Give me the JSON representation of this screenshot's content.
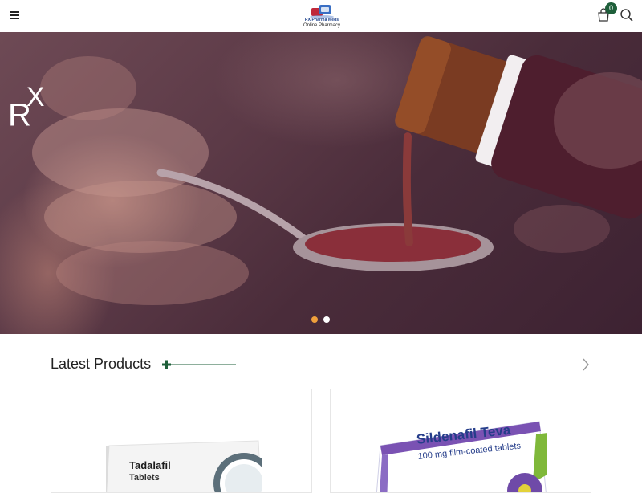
{
  "header": {
    "logo_title": "RX Pharma Meds",
    "logo_subtitle": "Online Pharmacy",
    "cart_count": "0"
  },
  "hero": {
    "rx_main": "R",
    "rx_sup": "X",
    "slides": 2,
    "active_slide": 1
  },
  "products_section": {
    "title": "Latest Products",
    "products": [
      {
        "name": "Tadalafil",
        "form": "Tablets"
      },
      {
        "name": "Sildenafil Teva",
        "form": "100 mg film-coated tablets"
      }
    ]
  },
  "colors": {
    "accent_green": "#1e5f3a",
    "slide_dot_active": "#f0a03c",
    "slide_dot_inactive": "#ffffff",
    "brand_blue": "#253d8a"
  },
  "icons": [
    "hamburger-menu-icon",
    "cart-icon",
    "search-icon",
    "plus-icon",
    "chevron-right-icon"
  ]
}
